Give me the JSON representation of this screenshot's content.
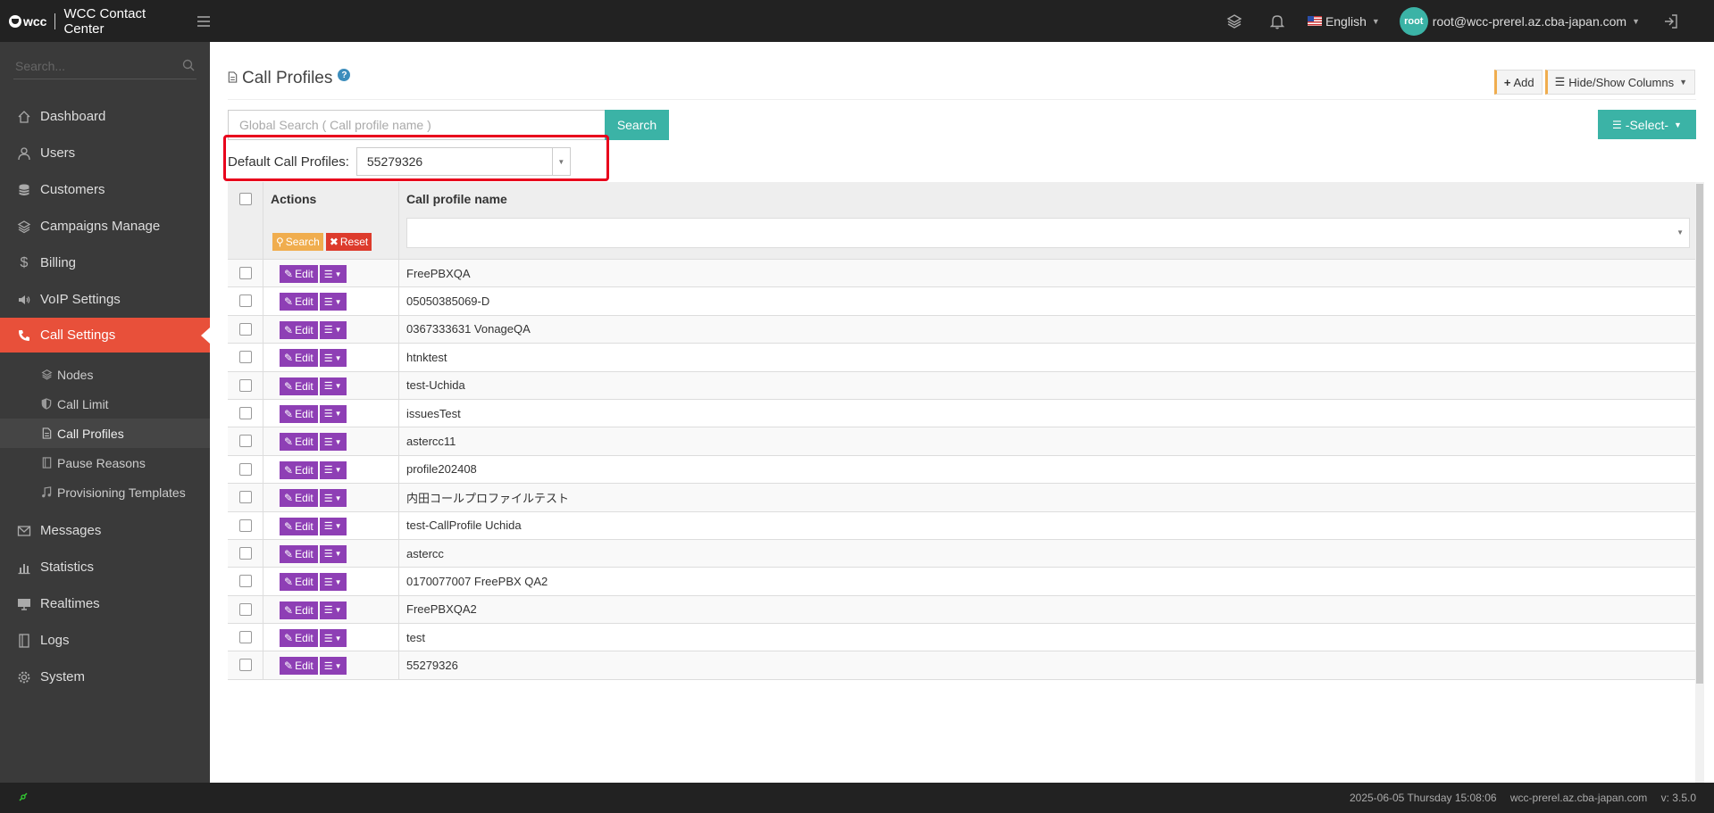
{
  "app": {
    "logo_text": "wcc",
    "title": "WCC Contact Center"
  },
  "topbar": {
    "language": "English",
    "avatar_text": "root",
    "user_email": "root@wcc-prerel.az.cba-japan.com"
  },
  "sidebar": {
    "search_placeholder": "Search...",
    "items": [
      {
        "label": "Dashboard",
        "icon": "home-icon"
      },
      {
        "label": "Users",
        "icon": "user-icon"
      },
      {
        "label": "Customers",
        "icon": "database-icon"
      },
      {
        "label": "Campaigns Manage",
        "icon": "layers-icon"
      },
      {
        "label": "Billing",
        "icon": "dollar-icon"
      },
      {
        "label": "VoIP Settings",
        "icon": "speaker-icon"
      },
      {
        "label": "Call Settings",
        "icon": "phone-icon",
        "active": true
      }
    ],
    "subitems": [
      {
        "label": "Nodes",
        "icon": "layers-icon"
      },
      {
        "label": "Call Limit",
        "icon": "shield-icon"
      },
      {
        "label": "Call Profiles",
        "icon": "document-icon",
        "active": true
      },
      {
        "label": "Pause Reasons",
        "icon": "book-icon"
      },
      {
        "label": "Provisioning Templates",
        "icon": "music-icon"
      }
    ],
    "items_after": [
      {
        "label": "Messages",
        "icon": "envelope-icon"
      },
      {
        "label": "Statistics",
        "icon": "bar-chart-icon"
      },
      {
        "label": "Realtimes",
        "icon": "monitor-icon"
      },
      {
        "label": "Logs",
        "icon": "book-icon"
      },
      {
        "label": "System",
        "icon": "gear-icon"
      }
    ]
  },
  "page": {
    "title": "Call Profiles",
    "help": "?",
    "add_label": "Add",
    "hide_show_label": "Hide/Show Columns",
    "global_search_placeholder": "Global Search ( Call profile name )",
    "search_button": "Search",
    "select_label": "-Select-",
    "default_label": "Default Call Profiles:",
    "default_value": "55279326"
  },
  "table": {
    "headers": {
      "actions": "Actions",
      "name": "Call profile name"
    },
    "filter_search": "Search",
    "filter_reset": "Reset",
    "edit_label": "Edit",
    "rows": [
      "FreePBXQA",
      "05050385069-D",
      "0367333631 VonageQA",
      "htnktest",
      "test-Uchida",
      "issuesTest",
      "astercc11",
      "profile202408",
      "内田コールプロファイルテスト",
      "test-CallProfile Uchida",
      "astercc",
      "0170077007 FreePBX QA2",
      "FreePBXQA2",
      "test",
      "55279326"
    ]
  },
  "footer": {
    "datetime": "2025-06-05 Thursday 15:08:06",
    "host": "wcc-prerel.az.cba-japan.com",
    "version": "v: 3.5.0"
  },
  "colors": {
    "accent_teal": "#3bb3a6",
    "active_menu": "#e8503a",
    "edit_purple": "#8e3fb5",
    "highlight_red": "#e8001c"
  }
}
